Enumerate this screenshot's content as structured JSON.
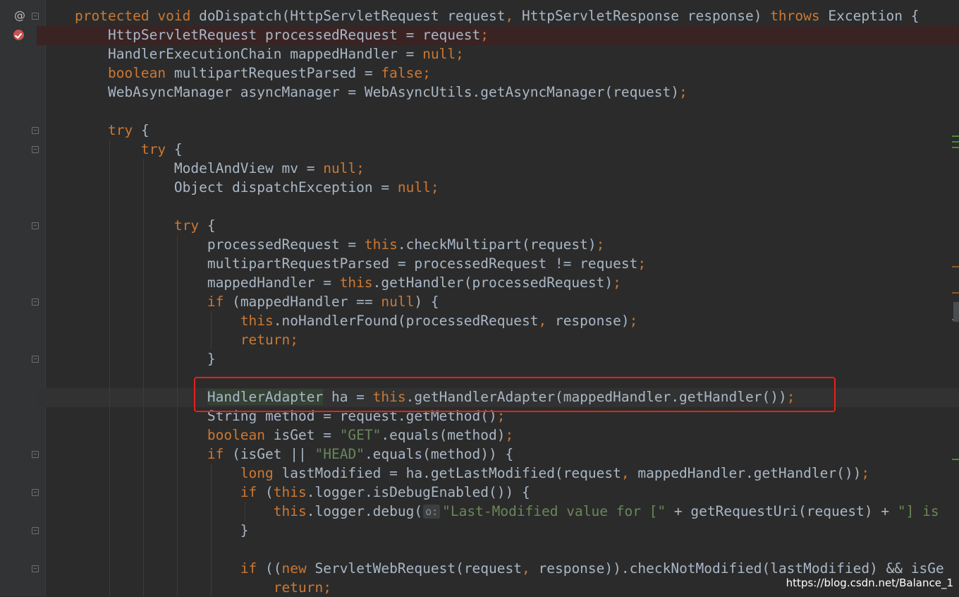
{
  "editor": {
    "gutter": {
      "override_marker": "@"
    },
    "lines": [
      [
        {
          "t": "protected void ",
          "c": "kw"
        },
        {
          "t": "doDispatch(HttpServletRequest request",
          "c": ""
        },
        {
          "t": ", ",
          "c": "pn"
        },
        {
          "t": "HttpServletResponse response) ",
          "c": ""
        },
        {
          "t": "throws ",
          "c": "kw"
        },
        {
          "t": "Exception {",
          "c": ""
        }
      ],
      [
        {
          "t": "    HttpServletRequest processedRequest = request",
          "c": ""
        },
        {
          "t": ";",
          "c": "pn"
        }
      ],
      [
        {
          "t": "    HandlerExecutionChain mappedHandler = ",
          "c": ""
        },
        {
          "t": "null;",
          "c": "kw"
        }
      ],
      [
        {
          "t": "    ",
          "c": ""
        },
        {
          "t": "boolean ",
          "c": "kw"
        },
        {
          "t": "multipartRequestParsed = ",
          "c": ""
        },
        {
          "t": "false;",
          "c": "kw"
        }
      ],
      [
        {
          "t": "    WebAsyncManager asyncManager = WebAsyncUtils.getAsyncManager(request)",
          "c": ""
        },
        {
          "t": ";",
          "c": "pn"
        }
      ],
      [],
      [
        {
          "t": "    ",
          "c": ""
        },
        {
          "t": "try ",
          "c": "kw"
        },
        {
          "t": "{",
          "c": ""
        }
      ],
      [
        {
          "t": "        ",
          "c": ""
        },
        {
          "t": "try ",
          "c": "kw"
        },
        {
          "t": "{",
          "c": ""
        }
      ],
      [
        {
          "t": "            ModelAndView mv = ",
          "c": ""
        },
        {
          "t": "null;",
          "c": "kw"
        }
      ],
      [
        {
          "t": "            Object dispatchException = ",
          "c": ""
        },
        {
          "t": "null;",
          "c": "kw"
        }
      ],
      [],
      [
        {
          "t": "            ",
          "c": ""
        },
        {
          "t": "try ",
          "c": "kw"
        },
        {
          "t": "{",
          "c": ""
        }
      ],
      [
        {
          "t": "                processedRequest = ",
          "c": ""
        },
        {
          "t": "this",
          "c": "kw"
        },
        {
          "t": ".checkMultipart(request)",
          "c": ""
        },
        {
          "t": ";",
          "c": "pn"
        }
      ],
      [
        {
          "t": "                multipartRequestParsed = processedRequest != request",
          "c": ""
        },
        {
          "t": ";",
          "c": "pn"
        }
      ],
      [
        {
          "t": "                mappedHandler = ",
          "c": ""
        },
        {
          "t": "this",
          "c": "kw"
        },
        {
          "t": ".getHandler(processedRequest)",
          "c": ""
        },
        {
          "t": ";",
          "c": "pn"
        }
      ],
      [
        {
          "t": "                ",
          "c": ""
        },
        {
          "t": "if ",
          "c": "kw"
        },
        {
          "t": "(mappedHandler == ",
          "c": ""
        },
        {
          "t": "null",
          "c": "kw"
        },
        {
          "t": ") {",
          "c": ""
        }
      ],
      [
        {
          "t": "                    ",
          "c": ""
        },
        {
          "t": "this",
          "c": "kw"
        },
        {
          "t": ".noHandlerFound(processedRequest",
          "c": ""
        },
        {
          "t": ", ",
          "c": "pn"
        },
        {
          "t": "response)",
          "c": ""
        },
        {
          "t": ";",
          "c": "pn"
        }
      ],
      [
        {
          "t": "                    ",
          "c": ""
        },
        {
          "t": "return;",
          "c": "kw"
        }
      ],
      [
        {
          "t": "                }",
          "c": ""
        }
      ],
      [],
      [
        {
          "t": "                ",
          "c": ""
        },
        {
          "t": "HandlerAdapter",
          "c": "hit"
        },
        {
          "t": " ha = ",
          "c": ""
        },
        {
          "t": "this",
          "c": "kw"
        },
        {
          "t": ".getHandlerAdapter(mappedHandler.getHandler())",
          "c": ""
        },
        {
          "t": ";",
          "c": "pn"
        }
      ],
      [
        {
          "t": "                String method = request.getMethod()",
          "c": ""
        },
        {
          "t": ";",
          "c": "pn"
        }
      ],
      [
        {
          "t": "                ",
          "c": ""
        },
        {
          "t": "boolean ",
          "c": "kw"
        },
        {
          "t": "isGet = ",
          "c": ""
        },
        {
          "t": "\"GET\"",
          "c": "st"
        },
        {
          "t": ".equals(method)",
          "c": ""
        },
        {
          "t": ";",
          "c": "pn"
        }
      ],
      [
        {
          "t": "                ",
          "c": ""
        },
        {
          "t": "if ",
          "c": "kw"
        },
        {
          "t": "(isGet || ",
          "c": ""
        },
        {
          "t": "\"HEAD\"",
          "c": "st"
        },
        {
          "t": ".equals(method)) {",
          "c": ""
        }
      ],
      [
        {
          "t": "                    ",
          "c": ""
        },
        {
          "t": "long ",
          "c": "kw"
        },
        {
          "t": "lastModified = ha.getLastModified(request",
          "c": ""
        },
        {
          "t": ", ",
          "c": "pn"
        },
        {
          "t": "mappedHandler.getHandler())",
          "c": ""
        },
        {
          "t": ";",
          "c": "pn"
        }
      ],
      [
        {
          "t": "                    ",
          "c": ""
        },
        {
          "t": "if ",
          "c": "kw"
        },
        {
          "t": "(",
          "c": ""
        },
        {
          "t": "this",
          "c": "kw"
        },
        {
          "t": ".logger.isDebugEnabled()) {",
          "c": ""
        }
      ],
      [
        {
          "t": "                        ",
          "c": ""
        },
        {
          "t": "this",
          "c": "kw"
        },
        {
          "t": ".logger.debug(",
          "c": ""
        },
        {
          "t": "o:",
          "c": "hint"
        },
        {
          "t": "\"Last-Modified value for [\"",
          "c": "st"
        },
        {
          "t": " + getRequestUri(request) + ",
          "c": ""
        },
        {
          "t": "\"] is",
          "c": "st"
        }
      ],
      [
        {
          "t": "                    }",
          "c": ""
        }
      ],
      [],
      [
        {
          "t": "                    ",
          "c": ""
        },
        {
          "t": "if ",
          "c": "kw"
        },
        {
          "t": "((",
          "c": ""
        },
        {
          "t": "new ",
          "c": "kw"
        },
        {
          "t": "ServletWebRequest(request",
          "c": ""
        },
        {
          "t": ", ",
          "c": "pn"
        },
        {
          "t": "response)).checkNotModified(lastModified) && isGe",
          "c": ""
        }
      ],
      [
        {
          "t": "                        ",
          "c": ""
        },
        {
          "t": "return;",
          "c": "kw"
        }
      ]
    ]
  },
  "colors": {
    "background": "#2b2b2b",
    "gutter": "#313335",
    "keyword": "#cc7832",
    "string": "#6a8759",
    "text": "#a9b7c6",
    "highlight_box": "#e8201a",
    "breakpoint": "#c75450"
  },
  "icons": [
    "override-marker-icon",
    "breakpoint-icon",
    "fold-marker-icon"
  ],
  "watermark": "https://blog.csdn.net/Balance_1"
}
